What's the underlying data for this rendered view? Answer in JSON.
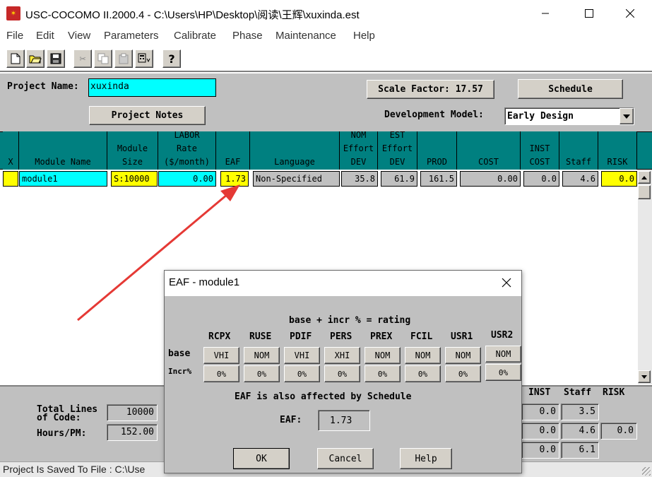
{
  "window": {
    "title": "USC-COCOMO II.2000.4 - C:\\Users\\HP\\Desktop\\阅读\\王辉\\xuxinda.est"
  },
  "menu": [
    "File",
    "Edit",
    "View",
    "Parameters",
    "Calibrate",
    "Phase",
    "Maintenance",
    "Help"
  ],
  "toolbar": [
    "new-file-icon",
    "open-folder-icon",
    "save-disk-icon",
    "cut-icon",
    "copy-icon",
    "paste-icon",
    "calculator-icon",
    "help-question-icon"
  ],
  "project": {
    "name_label": "Project Name:",
    "name_value": "xuxinda",
    "scale_factor_label": "Scale Factor: 17.57",
    "schedule_label": "Schedule",
    "notes_label": "Project Notes",
    "dev_model_label": "Development Model:",
    "dev_model_value": "Early Design"
  },
  "table": {
    "headers": [
      "X",
      "Module Name",
      "Module\nSize",
      "LABOR\nRate\n($/month)",
      "EAF",
      "Language",
      "NOM\nEffort\nDEV",
      "EST\nEffort\nDEV",
      "PROD",
      "COST",
      "INST\nCOST",
      "Staff",
      "RISK"
    ],
    "row": {
      "x": "",
      "name": "module1",
      "size": "S:10000",
      "labor": "0.00",
      "eaf": "1.73",
      "language": "Non-Specified",
      "nom": "35.8",
      "est": "61.9",
      "prod": "161.5",
      "cost": "0.00",
      "inst": "0.0",
      "staff": "4.6",
      "risk": "0.0"
    }
  },
  "bottom": {
    "total_lines_label": "Total Lines\nof Code:",
    "total_lines_value": "10000",
    "hours_label": "Hours/PM:",
    "hours_value": "152.00",
    "col_headers": [
      "INST",
      "Staff",
      "RISK"
    ],
    "rows": [
      {
        "inst": "0.0",
        "staff": "3.5",
        "risk": ""
      },
      {
        "inst": "0.0",
        "staff": "4.6",
        "risk": "0.0"
      },
      {
        "inst": "0.0",
        "staff": "6.1",
        "risk": ""
      }
    ]
  },
  "status": {
    "text": "Project Is Saved To File : C:\\Use"
  },
  "dialog": {
    "title": "EAF - module1",
    "subtitle": "base + incr % = rating",
    "drivers": [
      "RCPX",
      "RUSE",
      "PDIF",
      "PERS",
      "PREX",
      "FCIL",
      "USR1",
      "USR2"
    ],
    "base_label": "base",
    "incr_label": "Incr%",
    "base_values": [
      "VHI",
      "NOM",
      "VHI",
      "XHI",
      "NOM",
      "NOM",
      "NOM",
      "NOM"
    ],
    "incr_values": [
      "0%",
      "0%",
      "0%",
      "0%",
      "0%",
      "0%",
      "0%",
      "0%"
    ],
    "note": "EAF is also affected by Schedule",
    "eaf_label": "EAF:",
    "eaf_value": "1.73",
    "ok_label": "OK",
    "cancel_label": "Cancel",
    "help_label": "Help"
  },
  "colors": {
    "teal": "#008080",
    "cyan": "#00ffff",
    "yellow": "#ffff00",
    "gray": "#c0c0c0",
    "arrow": "#e53935"
  }
}
